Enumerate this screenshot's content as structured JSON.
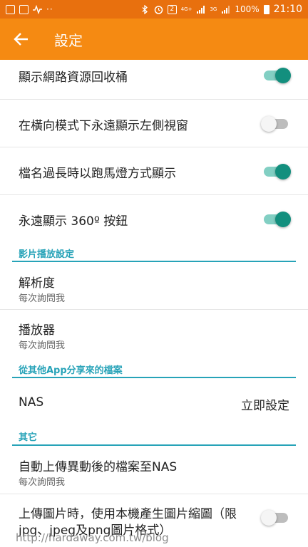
{
  "status_bar": {
    "notification_icons": [
      "gallery-icon",
      "cast-icon",
      "pulse-icon"
    ],
    "dots": "··",
    "system_icons": [
      "bluetooth-icon",
      "alarm-icon",
      "sim2-icon",
      "4g-signal-icon",
      "3g-signal-icon"
    ],
    "sim_label": "2",
    "net_4g": "4G+",
    "net_3g": "3G",
    "battery": "100%",
    "time": "21:10"
  },
  "app_bar": {
    "title": "設定",
    "back_icon": "arrow-left-icon"
  },
  "settings": [
    {
      "type": "toggle",
      "title": "顯示網路資源回收桶",
      "checked": true
    },
    {
      "type": "toggle",
      "title": "在橫向模式下永遠顯示左側視窗",
      "checked": false
    },
    {
      "type": "toggle",
      "title": "檔名過長時以跑馬燈方式顯示",
      "checked": true
    },
    {
      "type": "toggle",
      "title": "永遠顯示 360º 按鈕",
      "checked": true
    }
  ],
  "section_video": {
    "label": "影片播放設定",
    "items": [
      {
        "title": "解析度",
        "subtitle": "每次詢問我"
      },
      {
        "title": "播放器",
        "subtitle": "每次詢問我"
      }
    ]
  },
  "section_share": {
    "label": "從其他App分享來的檔案",
    "items": [
      {
        "title": "NAS",
        "value": "立即設定"
      }
    ]
  },
  "section_other": {
    "label": "其它",
    "items": [
      {
        "title": "自動上傳異動後的檔案至NAS",
        "subtitle": "每次詢問我"
      },
      {
        "title_line1": "上傳圖片時，使用本機產生圖片縮圖（限",
        "title_line2": "jpg、jpeg及png圖片格式）",
        "checked": false
      }
    ]
  },
  "watermark": "http://hardaway.com.tw/blog",
  "colors": {
    "status_bar": "#e8700e",
    "app_bar": "#f58a12",
    "section_accent": "#27a3b8",
    "toggle_on": "#138f7e"
  }
}
